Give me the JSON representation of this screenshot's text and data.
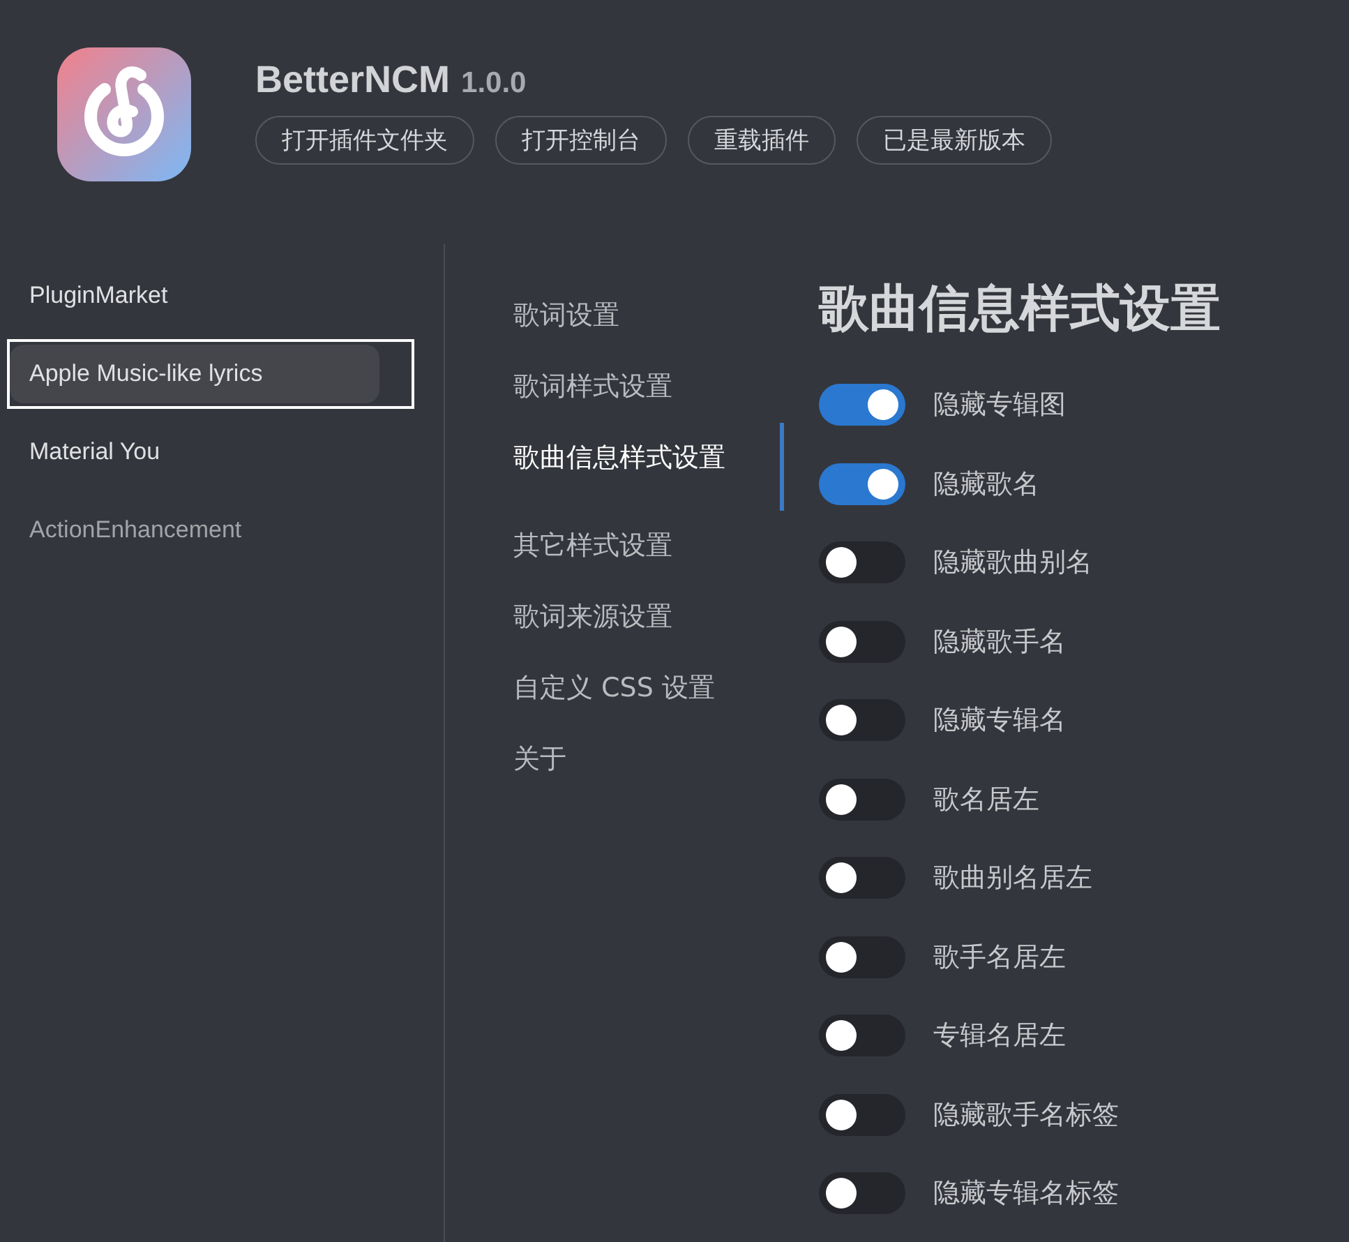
{
  "app": {
    "name": "BetterNCM",
    "version": "1.0.0"
  },
  "header_buttons": [
    "打开插件文件夹",
    "打开控制台",
    "重载插件",
    "已是最新版本"
  ],
  "sidebar": {
    "items": [
      {
        "label": "PluginMarket",
        "selected": false,
        "disabled": false,
        "highlighted": false
      },
      {
        "label": "Apple Music-like lyrics",
        "selected": true,
        "disabled": false,
        "highlighted": true
      },
      {
        "label": "Material You",
        "selected": false,
        "disabled": false,
        "highlighted": false
      },
      {
        "label": "ActionEnhancement",
        "selected": false,
        "disabled": true,
        "highlighted": false
      }
    ]
  },
  "settings_nav": {
    "items": [
      {
        "label": "歌词设置",
        "selected": false
      },
      {
        "label": "歌词样式设置",
        "selected": false
      },
      {
        "label": "歌曲信息样式设置",
        "selected": true
      },
      {
        "label": "其它样式设置",
        "selected": false
      },
      {
        "label": "歌词来源设置",
        "selected": false
      },
      {
        "label": "自定义 CSS 设置",
        "selected": false
      },
      {
        "label": "关于",
        "selected": false
      }
    ]
  },
  "panel": {
    "title": "歌曲信息样式设置",
    "toggles": [
      {
        "label": "隐藏专辑图",
        "on": true
      },
      {
        "label": "隐藏歌名",
        "on": true
      },
      {
        "label": "隐藏歌曲别名",
        "on": false
      },
      {
        "label": "隐藏歌手名",
        "on": false
      },
      {
        "label": "隐藏专辑名",
        "on": false
      },
      {
        "label": "歌名居左",
        "on": false
      },
      {
        "label": "歌曲别名居左",
        "on": false
      },
      {
        "label": "歌手名居左",
        "on": false
      },
      {
        "label": "专辑名居左",
        "on": false
      },
      {
        "label": "隐藏歌手名标签",
        "on": false
      },
      {
        "label": "隐藏专辑名标签",
        "on": false
      }
    ]
  }
}
